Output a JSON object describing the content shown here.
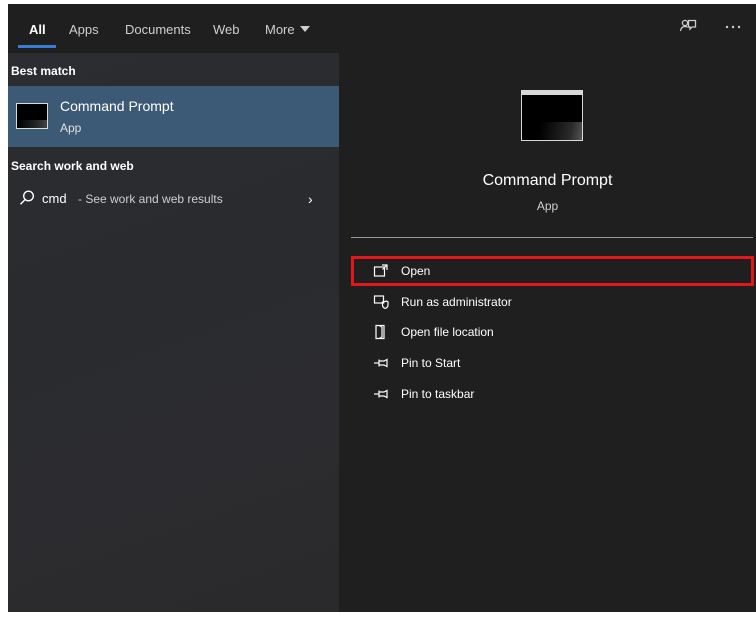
{
  "tabs": [
    {
      "label": "All"
    },
    {
      "label": "Apps"
    },
    {
      "label": "Documents"
    },
    {
      "label": "Web"
    },
    {
      "label": "More"
    }
  ],
  "sections": {
    "best_match": "Best match",
    "search_web": "Search work and web"
  },
  "best_match": {
    "title": "Command Prompt",
    "subtitle": "App"
  },
  "web_result": {
    "query": "cmd",
    "hint": " - See work and web results"
  },
  "detail": {
    "title": "Command Prompt",
    "subtitle": "App"
  },
  "actions": [
    {
      "label": "Open",
      "icon": "open-icon"
    },
    {
      "label": "Run as administrator",
      "icon": "shield-icon"
    },
    {
      "label": "Open file location",
      "icon": "file-location-icon"
    },
    {
      "label": "Pin to Start",
      "icon": "pin-icon"
    },
    {
      "label": "Pin to taskbar",
      "icon": "pin-icon"
    }
  ],
  "colors": {
    "selection": "#3c5a76",
    "highlight_border": "#e3161b",
    "tab_underline": "#3a7bd5"
  }
}
